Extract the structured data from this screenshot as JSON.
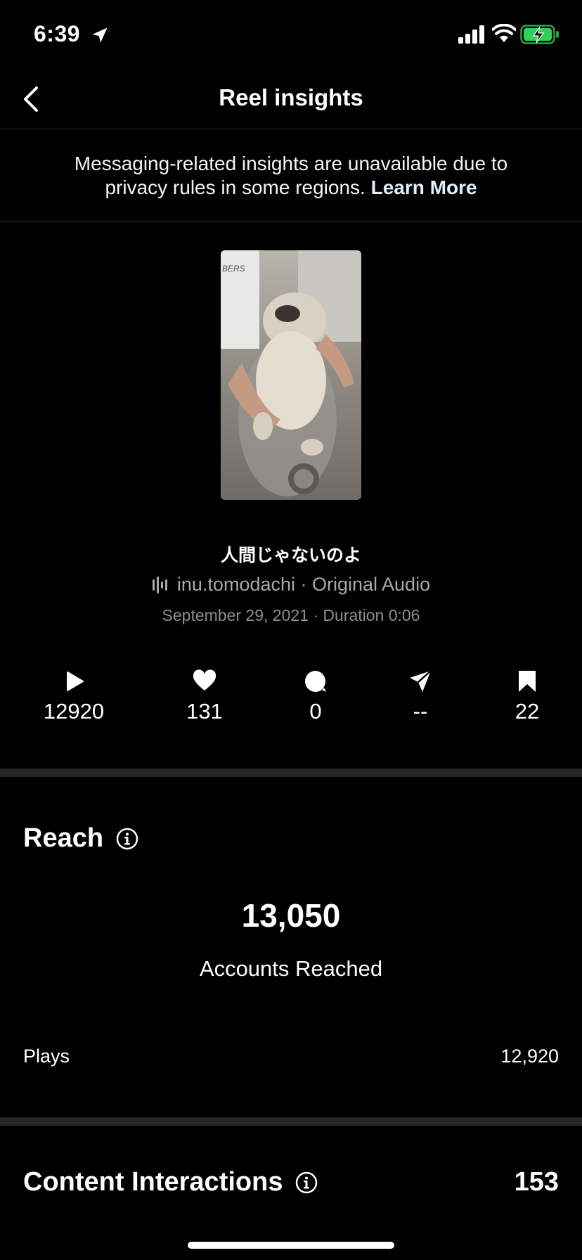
{
  "status_bar": {
    "time": "6:39"
  },
  "nav": {
    "title": "Reel insights"
  },
  "notice": {
    "text": "Messaging-related insights are unavailable due to privacy rules in some regions. ",
    "link": "Learn More"
  },
  "reel": {
    "title": "人間じゃないのよ",
    "audio": "inu.tomodachi · Original Audio",
    "meta": "September 29, 2021 · Duration 0:06"
  },
  "stats": {
    "plays": "12920",
    "likes": "131",
    "comments": "0",
    "shares": "--",
    "saves": "22"
  },
  "reach": {
    "title": "Reach",
    "accounts_reached_value": "13,050",
    "accounts_reached_label": "Accounts Reached",
    "plays_label": "Plays",
    "plays_value": "12,920"
  },
  "content_interactions": {
    "title": "Content Interactions",
    "total": "153"
  },
  "colors": {
    "background": "#000000",
    "divider": "#262626",
    "secondary_text": "#a8a8a8",
    "battery_green": "#30d158"
  }
}
